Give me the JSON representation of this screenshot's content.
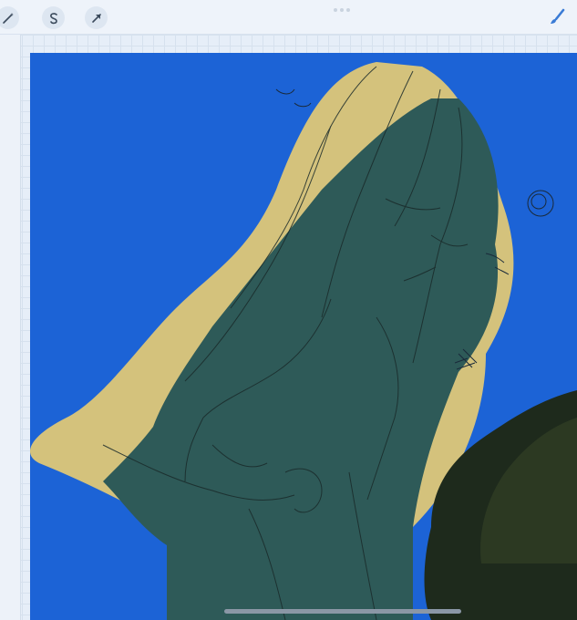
{
  "app": {
    "colors": {
      "toolbar_bg": "#eef3fa",
      "canvas_bg": "#1c63d6",
      "hair": "#d4c27c",
      "figure": "#2e5a58",
      "rock": "#1e2a1c",
      "brush_accent": "#3a7bd5"
    }
  },
  "toolbar": {
    "tools": [
      {
        "name": "magic-wand",
        "icon": "magic-wand-icon"
      },
      {
        "name": "selection",
        "icon": "selection-icon"
      },
      {
        "name": "transform",
        "icon": "transform-arrow-icon"
      }
    ],
    "right_tools": [
      {
        "name": "brush",
        "icon": "paint-brush-icon"
      }
    ]
  },
  "canvas": {
    "background_color": "#1c63d6",
    "content": "artwork"
  }
}
